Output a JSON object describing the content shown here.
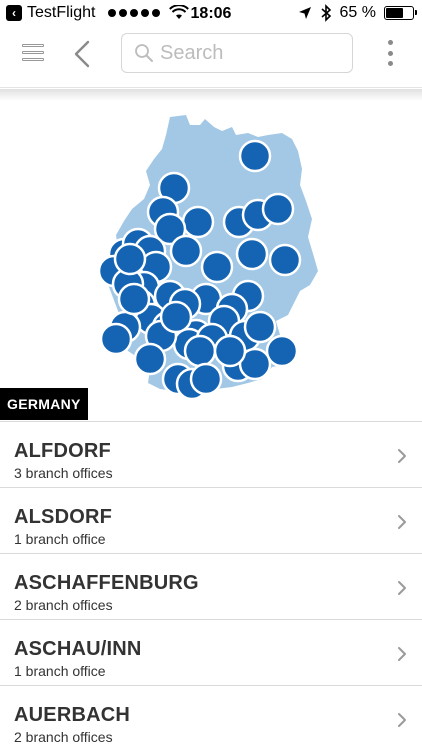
{
  "status_bar": {
    "app_back_label": "TestFlight",
    "time": "18:06",
    "battery_text": "65 %",
    "battery_level": 0.65
  },
  "toolbar": {
    "search_placeholder": "Search"
  },
  "map": {
    "country_label": "GERMANY",
    "land_color": "#a3c8e6",
    "marker_color": "#1564b3",
    "marker_count": 48
  },
  "list": {
    "items": [
      {
        "name": "ALFDORF",
        "subtitle": "3 branch offices"
      },
      {
        "name": "ALSDORF",
        "subtitle": "1 branch office"
      },
      {
        "name": "ASCHAFFENBURG",
        "subtitle": "2 branch offices"
      },
      {
        "name": "ASCHAU/INN",
        "subtitle": "1 branch office"
      },
      {
        "name": "AUERBACH",
        "subtitle": "2 branch offices"
      }
    ]
  }
}
